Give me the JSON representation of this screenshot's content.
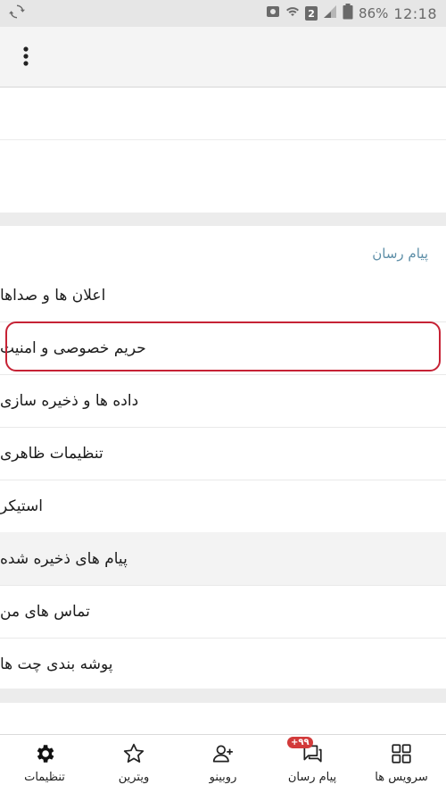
{
  "status_bar": {
    "battery_percent": "86%",
    "time": "12:18",
    "sim_badge": "2"
  },
  "app_bar": {
    "menu_icon": "more-vertical-icon"
  },
  "messenger_section": {
    "header": "پیام رسان",
    "items": [
      {
        "label": "اعلان ها و صداها"
      },
      {
        "label": "حریم خصوصی و امنیت",
        "highlighted": true
      },
      {
        "label": "داده ها و ذخیره سازی"
      },
      {
        "label": "تنظیمات ظاهری"
      },
      {
        "label": "استیکر"
      },
      {
        "label": "پیام های ذخیره شده"
      },
      {
        "label": "تماس های من"
      },
      {
        "label": "پوشه بندی چت ها"
      }
    ]
  },
  "bottom_nav": {
    "items": [
      {
        "label": "تنظیمات",
        "icon": "gear-icon",
        "active": true
      },
      {
        "label": "ویترین",
        "icon": "star-icon"
      },
      {
        "label": "روبینو",
        "icon": "add-user-icon"
      },
      {
        "label": "پیام رسان",
        "icon": "chat-icon",
        "badge": "+۹۹"
      },
      {
        "label": "سرویس ها",
        "icon": "grid-icon"
      }
    ]
  },
  "colors": {
    "highlight": "#c62235",
    "section_header": "#5e8fa8",
    "badge": "#d23a3a"
  }
}
